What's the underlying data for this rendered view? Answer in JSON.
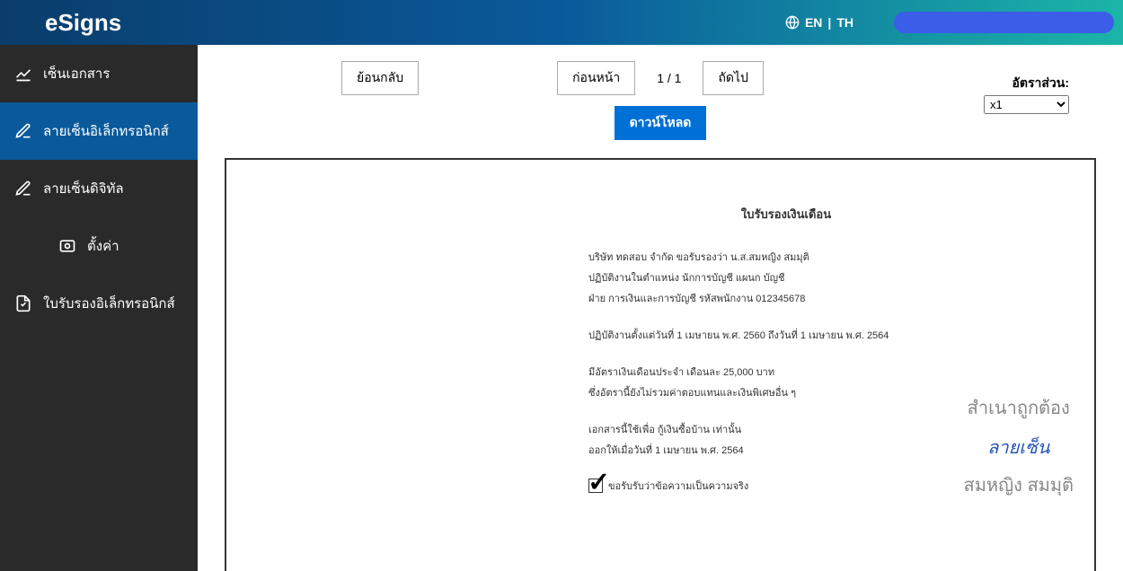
{
  "header": {
    "logo": "eSigns",
    "lang_en": "EN",
    "lang_divider": " | ",
    "lang_th": "TH"
  },
  "sidebar": {
    "items": [
      {
        "label": "เซ็นเอกสาร",
        "icon": "pen-icon"
      },
      {
        "label": "ลายเซ็นอิเล็กทรอนิกส์",
        "icon": "edit-icon",
        "active": true
      },
      {
        "label": "ลายเซ็นดิจิทัล",
        "icon": "edit-icon"
      },
      {
        "label": "ตั้งค่า",
        "icon": "settings-icon",
        "indent": true
      },
      {
        "label": "ใบรับรองอิเล็กทรอนิกส์",
        "icon": "cert-icon"
      }
    ]
  },
  "toolbar": {
    "back": "ย้อนกลับ",
    "prev": "ก่อนหน้า",
    "page": "1 / 1",
    "next": "ถัดไป",
    "download": "ดาวน์โหลด",
    "ratio_label": "อัตราส่วน:",
    "ratio_value": "x1"
  },
  "doc": {
    "title": "ใบรับรองเงินเดือน",
    "line1": "บริษัท ทดสอบ จำกัด  ขอรับรองว่า น.ส.สมหญิง สมมุติ",
    "line2": "ปฏิบัติงานในตำแหน่ง นักการบัญชี  แผนก บัญชี",
    "line3": "ฝ่าย การเงินและการบัญชี รหัสพนักงาน 012345678",
    "line4": "ปฏิบัติงานตั้งแต่วันที่ 1 เมษายน พ.ศ. 2560 ถึงวันที่ 1 เมษายน พ.ศ. 2564",
    "line5": "มีอัตราเงินเดือนประจำ เดือนละ 25,000 บาท",
    "line6": "ซึ่งอัตรานี้ยังไม่รวมค่าตอบแทนและเงินพิเศษอื่น ๆ",
    "line7": "เอกสารนี้ใช้เพื่อ กู้เงินซื้อบ้าน เท่านั้น",
    "line8": "ออกให้เมื่อวันที่ 1 เมษายน พ.ศ. 2564",
    "check_text": "ขอรับรับว่าข้อความเป็นความจริง"
  },
  "stamp": {
    "correct": "สำเนาถูกต้อง",
    "signature": "ลายเซ็น",
    "name": "สมหญิง สมมุติ"
  }
}
